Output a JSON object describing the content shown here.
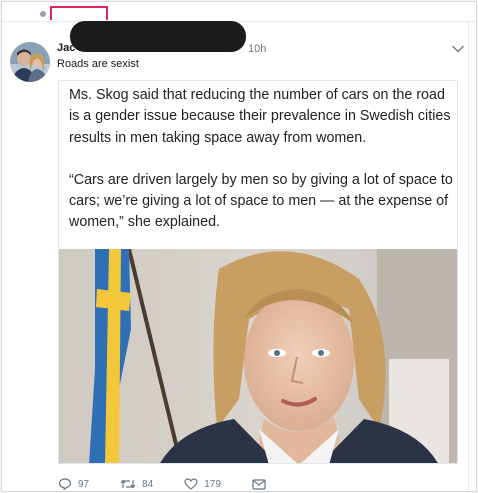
{
  "tweet": {
    "author_name": "Jac",
    "timestamp": "10h",
    "caption": "Roads are sexist"
  },
  "quote": {
    "paragraph_1": "Ms. Skog said that reducing the number of cars on the road is a gender issue because their prevalence in Swedish cities results in men taking space away from women.",
    "paragraph_2": "“Cars are driven largely by men so by giving a lot of space to cars; we’re giving a lot of space to men — at the expense of women,” she explained."
  },
  "actions": {
    "replies": "97",
    "retweets": "84",
    "likes": "179"
  },
  "colors": {
    "accent": "#e0245e",
    "muted_text": "#657786",
    "flag_blue": "#2f6fb5",
    "flag_yellow": "#f2c83a"
  },
  "icons": [
    "reply-icon",
    "retweet-icon",
    "like-icon",
    "message-icon",
    "chevron-down-icon"
  ]
}
